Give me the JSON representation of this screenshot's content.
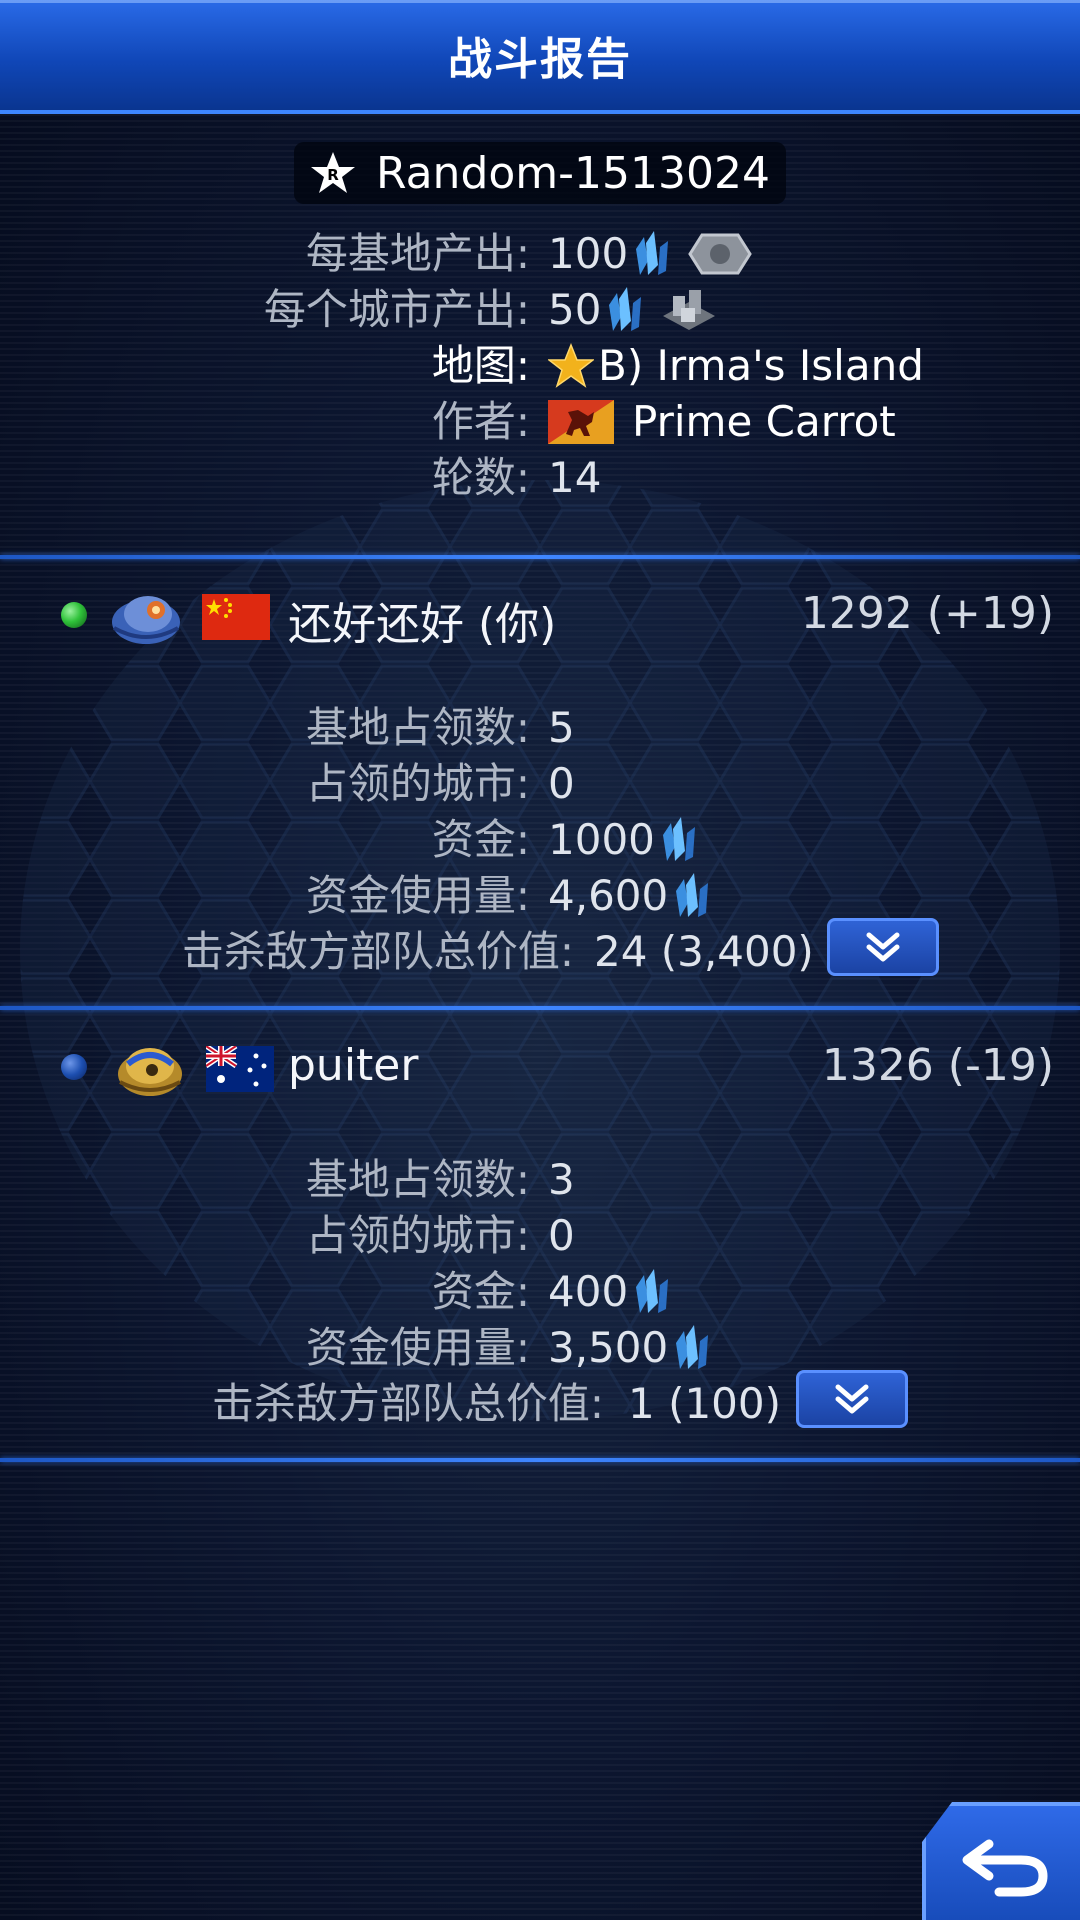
{
  "header": {
    "title": "战斗报告"
  },
  "game": {
    "name": "Random-1513024",
    "base_income_label": "每基地产出:",
    "base_income_value": "100",
    "city_income_label": "每个城市产出:",
    "city_income_value": "50",
    "map_label": "地图:",
    "map_value": "B) Irma's Island",
    "author_label": "作者:",
    "author_value": "Prime Carrot",
    "turns_label": "轮数:",
    "turns_value": "14"
  },
  "players": [
    {
      "name": "还好还好 (你)",
      "score": "1292 (+19)",
      "status_color": "#2fc23a",
      "flag": "china-flag",
      "stats": {
        "bases_label": "基地占领数:",
        "bases_value": "5",
        "cities_label": "占领的城市:",
        "cities_value": "0",
        "funds_label": "资金:",
        "funds_value": "1000",
        "funds_used_label": "资金使用量:",
        "funds_used_value": "4,600",
        "kills_label": "击杀敌方部队总价值:",
        "kills_value": "24 (3,400)"
      }
    },
    {
      "name": "puiter",
      "score": "1326 (-19)",
      "status_color": "#1d4fb0",
      "flag": "australia-flag",
      "stats": {
        "bases_label": "基地占领数:",
        "bases_value": "3",
        "cities_label": "占领的城市:",
        "cities_value": "0",
        "funds_label": "资金:",
        "funds_value": "400",
        "funds_used_label": "资金使用量:",
        "funds_used_value": "3,500",
        "kills_label": "击杀敌方部队总价值:",
        "kills_value": "1 (100)"
      }
    }
  ],
  "icons": {
    "crystal": "crystal-icon",
    "base": "base-icon",
    "city": "city-icon",
    "star": "star-icon",
    "rank": "rank-r-icon",
    "expand": "double-chevron-down-icon",
    "back": "back-arrow-icon"
  },
  "colors": {
    "title_bar": "#1a55d0",
    "divider": "#3f86ff",
    "button": "#2350c0"
  }
}
